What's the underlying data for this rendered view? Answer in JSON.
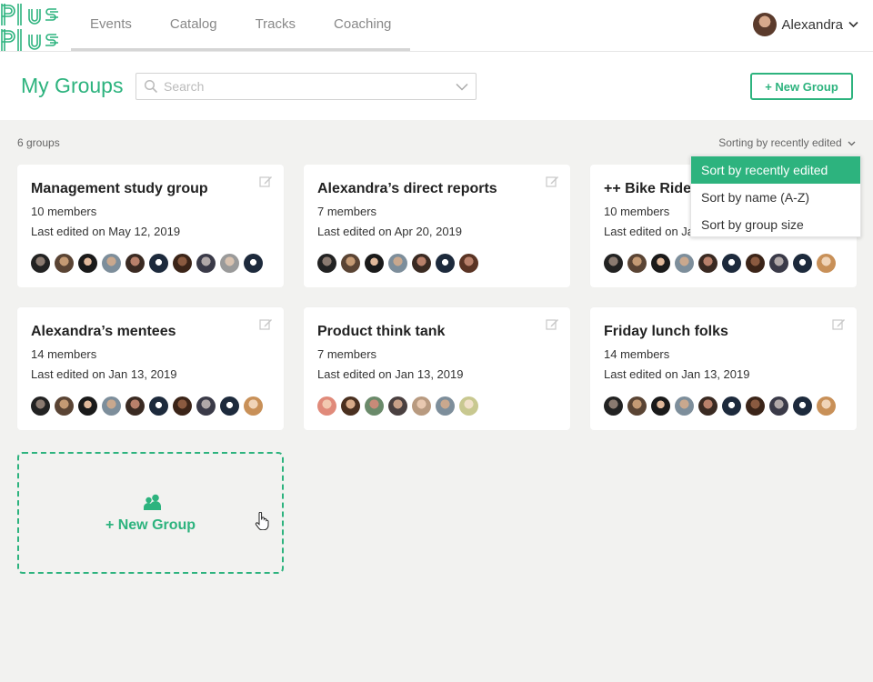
{
  "nav": {
    "tabs": [
      {
        "label": "Events"
      },
      {
        "label": "Catalog"
      },
      {
        "label": "Tracks"
      },
      {
        "label": "Coaching"
      }
    ],
    "user_name": "Alexandra"
  },
  "header": {
    "title": "My Groups",
    "search_placeholder": "Search",
    "new_group_button": "+ New Group"
  },
  "toolbar": {
    "count": "6 groups",
    "sort_label": "Sorting by recently edited"
  },
  "sort_menu": {
    "options": [
      {
        "label": "Sort by recently edited",
        "active": true
      },
      {
        "label": "Sort by name (A-Z)",
        "active": false
      },
      {
        "label": "Sort by group size",
        "active": false
      }
    ]
  },
  "groups": [
    {
      "name": "Management study group",
      "members": "10 members",
      "edited": "Last edited on May 12, 2019"
    },
    {
      "name": "Alexandra’s direct reports",
      "members": "7 members",
      "edited": "Last edited on Apr 20, 2019"
    },
    {
      "name": "++ Bike Rides",
      "members": "10 members",
      "edited": "Last edited on Jan 13, 2019"
    },
    {
      "name": "Alexandra’s mentees",
      "members": "14 members",
      "edited": "Last edited on Jan 13, 2019"
    },
    {
      "name": "Product think tank",
      "members": "7 members",
      "edited": "Last edited on Jan 13, 2019"
    },
    {
      "name": "Friday lunch folks",
      "members": "14 members",
      "edited": "Last edited on Jan 13, 2019"
    }
  ],
  "new_group_card": {
    "label": "+ New Group"
  },
  "colors": {
    "accent": "#2db37e",
    "background": "#f2f2f0"
  }
}
